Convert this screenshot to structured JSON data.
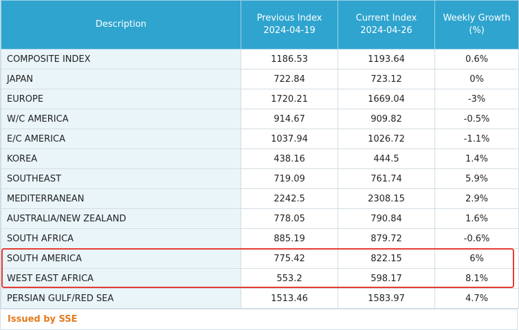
{
  "header": {
    "description": "Description",
    "previous_index_title": "Previous Index",
    "previous_index_date": "2024-04-19",
    "current_index_title": "Current Index",
    "current_index_date": "2024-04-26",
    "weekly_growth_title": "Weekly Growth",
    "weekly_growth_unit": "(%)"
  },
  "rows": [
    {
      "description": "COMPOSITE INDEX",
      "previous": "1186.53",
      "current": "1193.64",
      "growth": "0.6%"
    },
    {
      "description": "JAPAN",
      "previous": "722.84",
      "current": "723.12",
      "growth": "0%"
    },
    {
      "description": "EUROPE",
      "previous": "1720.21",
      "current": "1669.04",
      "growth": "-3%"
    },
    {
      "description": "W/C AMERICA",
      "previous": "914.67",
      "current": "909.82",
      "growth": "-0.5%"
    },
    {
      "description": "E/C AMERICA",
      "previous": "1037.94",
      "current": "1026.72",
      "growth": "-1.1%"
    },
    {
      "description": "KOREA",
      "previous": "438.16",
      "current": "444.5",
      "growth": "1.4%"
    },
    {
      "description": "SOUTHEAST",
      "previous": "719.09",
      "current": "761.74",
      "growth": "5.9%"
    },
    {
      "description": "MEDITERRANEAN",
      "previous": "2242.5",
      "current": "2308.15",
      "growth": "2.9%"
    },
    {
      "description": "AUSTRALIA/NEW ZEALAND",
      "previous": "778.05",
      "current": "790.84",
      "growth": "1.6%"
    },
    {
      "description": "SOUTH AFRICA",
      "previous": "885.19",
      "current": "879.72",
      "growth": "-0.6%"
    },
    {
      "description": "SOUTH AMERICA",
      "previous": "775.42",
      "current": "822.15",
      "growth": "6%"
    },
    {
      "description": "WEST EAST AFRICA",
      "previous": "553.2",
      "current": "598.17",
      "growth": "8.1%"
    },
    {
      "description": "PERSIAN GULF/RED SEA",
      "previous": "1513.46",
      "current": "1583.97",
      "growth": "4.7%"
    }
  ],
  "footer": {
    "issued_by": "Issued by SSE"
  },
  "colors": {
    "header_bg": "#2fa4cf",
    "description_bg": "#eaf5fa",
    "highlight_border": "#e53b32",
    "issued_text": "#e37a1d"
  }
}
